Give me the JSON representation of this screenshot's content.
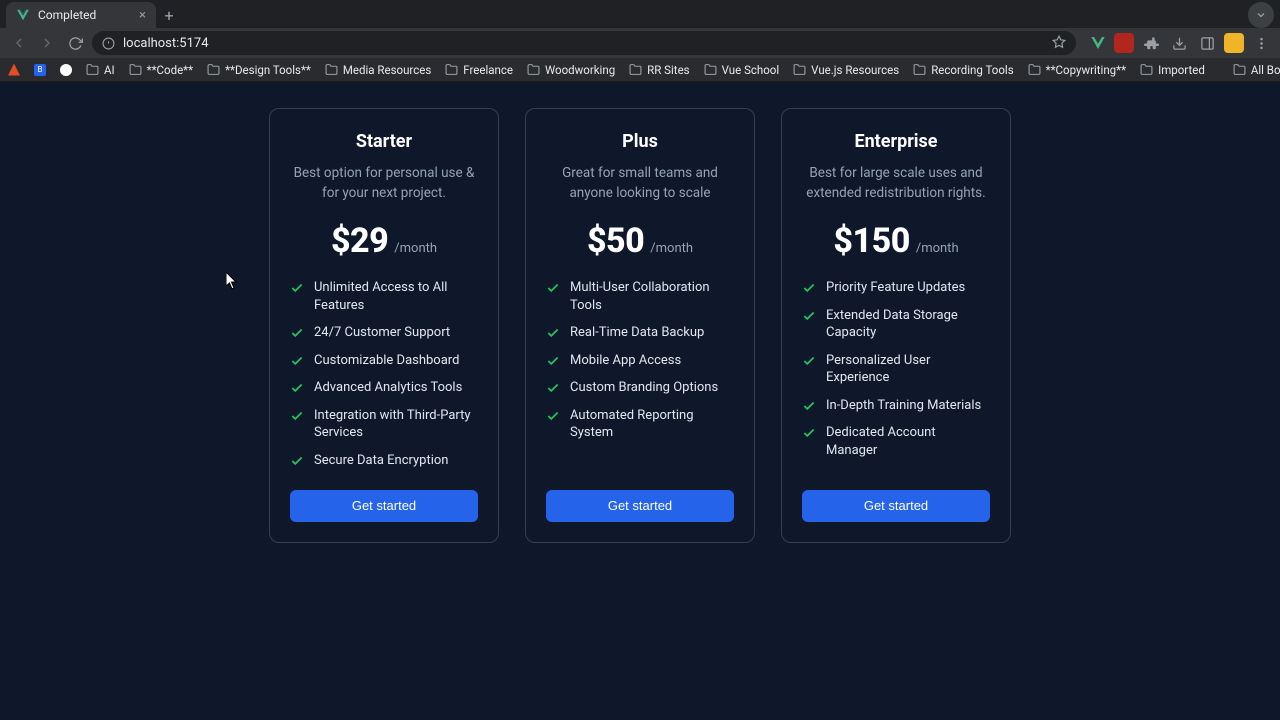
{
  "browser": {
    "tab_title": "Completed",
    "url": "localhost:5174",
    "bookmarks": [
      "AI",
      "**Code**",
      "**Design Tools**",
      "Media Resources",
      "Freelance",
      "Woodworking",
      "RR Sites",
      "Vue School",
      "Vue.js Resources",
      "Recording Tools",
      "**Copywriting**",
      "Imported"
    ],
    "all_bookmarks_label": "All Bookmarks"
  },
  "page": {
    "period_label": "/month",
    "cta_label": "Get started",
    "plans": [
      {
        "name": "Starter",
        "description": "Best option for personal use & for your next project.",
        "price": "$29",
        "features": [
          "Unlimited Access to All Features",
          "24/7 Customer Support",
          "Customizable Dashboard",
          "Advanced Analytics Tools",
          "Integration with Third-Party Services",
          "Secure Data Encryption"
        ]
      },
      {
        "name": "Plus",
        "description": "Great for small teams and anyone looking to scale",
        "price": "$50",
        "features": [
          "Multi-User Collaboration Tools",
          "Real-Time Data Backup",
          "Mobile App Access",
          "Custom Branding Options",
          "Automated Reporting System"
        ]
      },
      {
        "name": "Enterprise",
        "description": "Best for large scale uses and extended redistribution rights.",
        "price": "$150",
        "features": [
          "Priority Feature Updates",
          "Extended Data Storage Capacity",
          "Personalized User Experience",
          "In-Depth Training Materials",
          "Dedicated Account Manager"
        ]
      }
    ]
  }
}
